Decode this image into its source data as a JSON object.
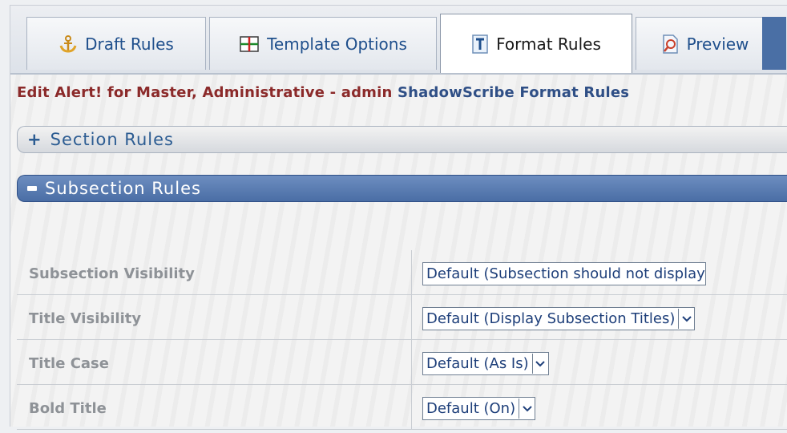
{
  "tabs": [
    {
      "label": "Draft Rules",
      "icon": "anchor-icon",
      "active": false
    },
    {
      "label": "Template Options",
      "icon": "table-icon",
      "active": false
    },
    {
      "label": "Format Rules",
      "icon": "text-format-icon",
      "active": true
    },
    {
      "label": "Preview",
      "icon": "preview-magnifier-icon",
      "active": false
    }
  ],
  "heading": {
    "part1": "Edit Alert! for Master, Administrative - admin",
    "part2": "ShadowScribe Format Rules"
  },
  "panels": {
    "section": {
      "toggle": "+",
      "label": "Section Rules"
    },
    "subsection": {
      "label": "Subsection Rules"
    }
  },
  "rules": [
    {
      "label": "Subsection Visibility",
      "value": "Default (Subsection should not display"
    },
    {
      "label": "Title Visibility",
      "value": "Default (Display Subsection Titles)"
    },
    {
      "label": "Title Case",
      "value": "Default (As Is)"
    },
    {
      "label": "Bold Title",
      "value": "Default (On)"
    }
  ],
  "colors": {
    "accent": "#4a6ea5",
    "heading_red": "#8b2a2a",
    "heading_blue": "#2f4f86",
    "label_gray": "#8e9297"
  }
}
